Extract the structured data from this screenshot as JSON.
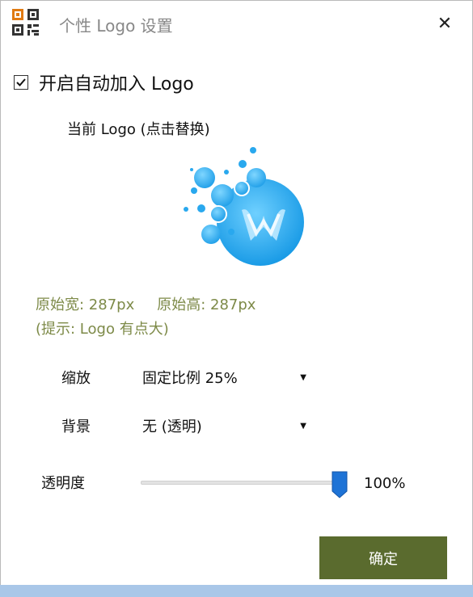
{
  "window": {
    "title": "个性 Logo 设置",
    "app_icon": "qr-code-icon",
    "close_icon": "close-icon",
    "close_symbol": "✕"
  },
  "auto_logo": {
    "checked": true,
    "label": "开启自动加入 Logo"
  },
  "logo": {
    "title": "当前 Logo (点击替换)",
    "preview_icon": "bubble-w-logo-icon",
    "width_text": "原始宽: 287px",
    "height_text": "原始高: 287px",
    "hint": "(提示: Logo 有点大)"
  },
  "scale": {
    "label": "缩放",
    "value": "固定比例 25%"
  },
  "background": {
    "label": "背景",
    "value": "无 (透明)"
  },
  "opacity": {
    "label": "透明度",
    "level": 1.0,
    "value_text": "100%"
  },
  "ok_button": {
    "label": "确定"
  },
  "colors": {
    "accent_green": "#5a6b2e",
    "info_green": "#7d8a48",
    "slider_blue": "#1e73d6",
    "logo_blue": "#29a8ee"
  }
}
